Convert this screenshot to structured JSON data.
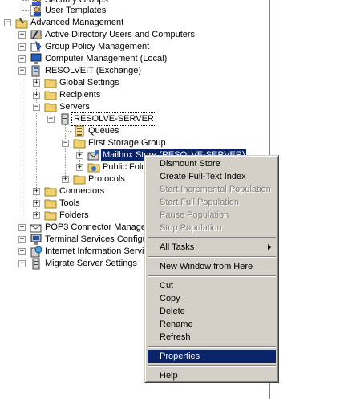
{
  "tree": {
    "rows": [
      {
        "label": "Security Groups"
      },
      {
        "label": "User Templates"
      },
      {
        "label": "Advanced Management"
      },
      {
        "label": "Active Directory Users and Computers"
      },
      {
        "label": "Group Policy Management"
      },
      {
        "label": "Computer Management (Local)"
      },
      {
        "label": "RESOLVEIT (Exchange)"
      },
      {
        "label": "Global Settings"
      },
      {
        "label": "Recipients"
      },
      {
        "label": "Servers"
      },
      {
        "label": "RESOLVE-SERVER"
      },
      {
        "label": "Queues"
      },
      {
        "label": "First Storage Group"
      },
      {
        "label": "Mailbox Store (RESOLVE-SERVER)"
      },
      {
        "label": "Public Folder Store (RESOLVE-SERVER)"
      },
      {
        "label": "Protocols"
      },
      {
        "label": "Connectors"
      },
      {
        "label": "Tools"
      },
      {
        "label": "Folders"
      },
      {
        "label": "POP3 Connector Manager"
      },
      {
        "label": "Terminal Services Configuration"
      },
      {
        "label": "Internet Information Services"
      },
      {
        "label": "Migrate Server Settings"
      }
    ]
  },
  "context_menu": {
    "items": [
      {
        "label": "Dismount Store",
        "enabled": true
      },
      {
        "label": "Create Full-Text Index",
        "enabled": true
      },
      {
        "label": "Start Incremental Population",
        "enabled": false
      },
      {
        "label": "Start Full Population",
        "enabled": false
      },
      {
        "label": "Pause Population",
        "enabled": false
      },
      {
        "label": "Stop Population",
        "enabled": false
      },
      {
        "label": "All Tasks",
        "enabled": true,
        "submenu": true
      },
      {
        "label": "New Window from Here",
        "enabled": true
      },
      {
        "label": "Cut",
        "enabled": true
      },
      {
        "label": "Copy",
        "enabled": true
      },
      {
        "label": "Delete",
        "enabled": true
      },
      {
        "label": "Rename",
        "enabled": true
      },
      {
        "label": "Refresh",
        "enabled": true
      },
      {
        "label": "Properties",
        "enabled": true,
        "highlighted": true
      },
      {
        "label": "Help",
        "enabled": true
      }
    ]
  },
  "colors": {
    "selection": "#0a246a",
    "menu_face": "#d4d0c8",
    "disabled_text": "#808080"
  }
}
